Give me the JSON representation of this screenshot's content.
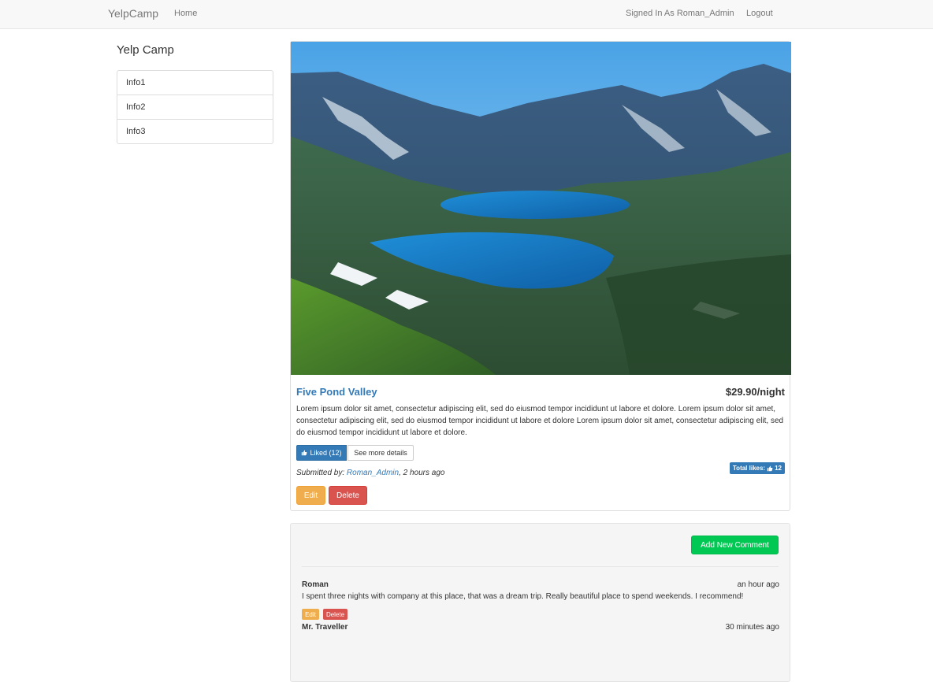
{
  "navbar": {
    "brand": "YelpCamp",
    "home": "Home",
    "signed_in": "Signed In As Roman_Admin",
    "logout": "Logout"
  },
  "sidebar": {
    "title": "Yelp Camp",
    "items": [
      {
        "label": "Info1"
      },
      {
        "label": "Info2"
      },
      {
        "label": "Info3"
      }
    ]
  },
  "campground": {
    "name": "Five Pond Valley",
    "price": "$29.90/night",
    "description": "Lorem ipsum dolor sit amet, consectetur adipiscing elit, sed do eiusmod tempor incididunt ut labore et dolore. Lorem ipsum dolor sit amet, consectetur adipiscing elit, sed do eiusmod tempor incididunt ut labore et dolore Lorem ipsum dolor sit amet, consectetur adipiscing elit, sed do eiusmod tempor incididunt ut labore et dolore.",
    "liked_label": "Liked (12)",
    "details_label": "See more details",
    "submitted_prefix": "Submitted by: ",
    "author": "Roman_Admin",
    "submitted_suffix": ", 2 hours ago",
    "total_likes_label": "Total likes:",
    "total_likes": "12",
    "edit_label": "Edit",
    "delete_label": "Delete",
    "image_icon": "mountain-lake-photo"
  },
  "comments": {
    "add_label": "Add New Comment",
    "items": [
      {
        "author": "Roman",
        "time": "an hour ago",
        "text": "I spent three nights with company at this place, that was a dream trip. Really beautiful place to spend weekends. I recommend!",
        "edit_label": "Edit",
        "delete_label": "Delete"
      },
      {
        "author": "Mr. Traveller",
        "time": "30 minutes ago"
      }
    ]
  },
  "colors": {
    "primary": "#337ab7",
    "warning": "#f0ad4e",
    "danger": "#d9534f",
    "success": "#00c853"
  }
}
